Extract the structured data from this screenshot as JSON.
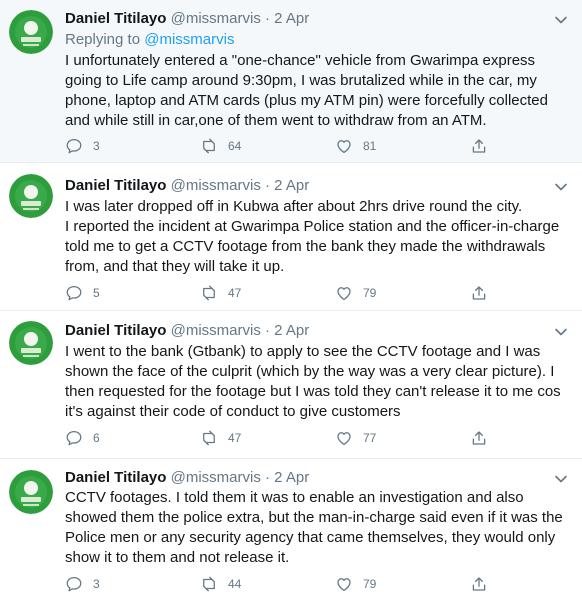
{
  "colors": {
    "link": "#1da1f2",
    "secondary_text": "#657786",
    "first_tweet_bg": "#f5f8fa",
    "avatar_green": "#2e9d3c"
  },
  "tweets": [
    {
      "author": "Daniel Titilayo",
      "handle": "@missmarvis",
      "separator": "·",
      "date": "2 Apr",
      "replying_prefix": "Replying to",
      "replying_to": "@missmarvis",
      "lines": [
        "I unfortunately entered a \"one-chance\" vehicle from Gwarimpa express",
        "going to Life camp around 9:30pm, I was brutalized while in the car, my",
        "phone, laptop and ATM cards (plus my ATM pin) were forcefully collected",
        "and while still in car,one of them went to withdraw from an ATM."
      ],
      "replies": "3",
      "retweets": "64",
      "likes": "81"
    },
    {
      "author": "Daniel Titilayo",
      "handle": "@missmarvis",
      "separator": "·",
      "date": "2 Apr",
      "lines": [
        "I was later dropped off in Kubwa after about 2hrs drive round the city.",
        "I reported the incident at Gwarimpa Police station and the officer-in-charge",
        "told me to get a CCTV footage from the bank they made the withdrawals",
        "from, and that they will take it up."
      ],
      "replies": "5",
      "retweets": "47",
      "likes": "79"
    },
    {
      "author": "Daniel Titilayo",
      "handle": "@missmarvis",
      "separator": "·",
      "date": "2 Apr",
      "lines": [
        "I went to the bank (Gtbank) to apply to see the CCTV footage and I was",
        "shown the face of the culprit (which by the way was a very clear picture). I",
        "then requested for the footage but I was told they can't release it to me cos",
        "it's against their code of conduct to give customers"
      ],
      "replies": "6",
      "retweets": "47",
      "likes": "77"
    },
    {
      "author": "Daniel Titilayo",
      "handle": "@missmarvis",
      "separator": "·",
      "date": "2 Apr",
      "lines": [
        "CCTV footages. I told them it was to enable an investigation and also",
        "showed them the police extra, but the man-in-charge said even if it was the",
        "Police men or any security agency that came themselves, they would only",
        "show it to them and not release it."
      ],
      "replies": "3",
      "retweets": "44",
      "likes": "79"
    }
  ]
}
